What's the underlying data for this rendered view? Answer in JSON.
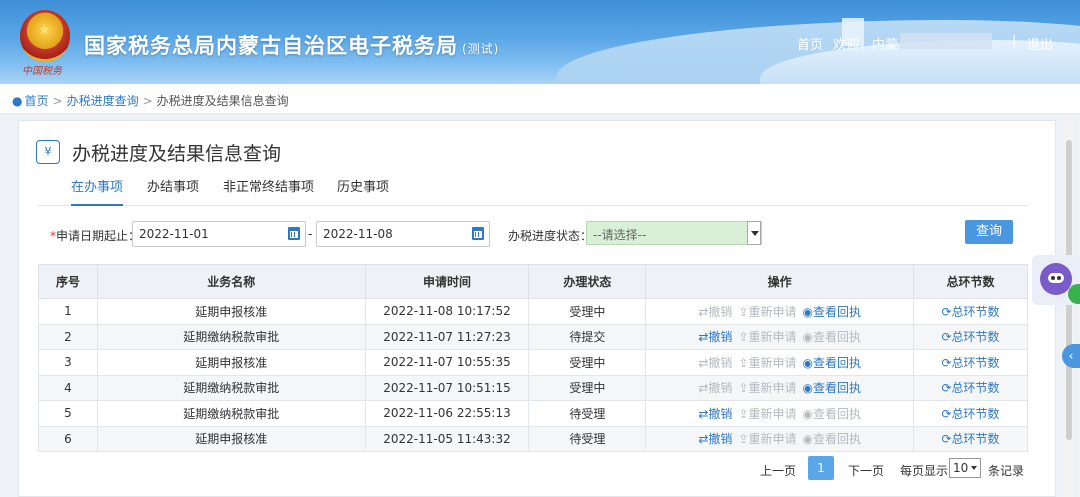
{
  "header": {
    "emblem_script": "中国税务",
    "title": "国家税务总局内蒙古自治区电子税务局",
    "subtitle": "(测试)",
    "nav_home": "首页",
    "welcome": "欢迎，内蒙",
    "separator": "|",
    "logout": "退出"
  },
  "breadcrumb": {
    "home": "首页",
    "arrow": ">",
    "level1": "办税进度查询",
    "level2": "办税进度及结果信息查询"
  },
  "page": {
    "icon_text": "¥",
    "title": "办税进度及结果信息查询",
    "tabs": [
      "在办事项",
      "办结事项",
      "非正常终结事项",
      "历史事项"
    ]
  },
  "filters": {
    "required_mark": "*",
    "date_label": "申请日期起止：",
    "date_start": "2022-11-01",
    "date_end": "2022-11-08",
    "dash": "-",
    "status_label": "办税进度状态：",
    "status_placeholder": "--请选择--",
    "query_button": "查询"
  },
  "table": {
    "headers": [
      "序号",
      "业务名称",
      "申请时间",
      "办理状态",
      "操作",
      "总环节数"
    ],
    "op_labels": {
      "revoke": "⇄撤销",
      "resubmit": "⇪重新申请",
      "view": "◉查看回执"
    },
    "total_label": "⟳总环节数",
    "rows": [
      {
        "no": "1",
        "name": "延期申报核准",
        "time": "2022-11-08 10:17:52",
        "status": "受理中",
        "revoke": false,
        "resubmit": false,
        "view": true
      },
      {
        "no": "2",
        "name": "延期缴纳税款审批",
        "time": "2022-11-07 11:27:23",
        "status": "待提交",
        "revoke": true,
        "resubmit": false,
        "view": false
      },
      {
        "no": "3",
        "name": "延期申报核准",
        "time": "2022-11-07 10:55:35",
        "status": "受理中",
        "revoke": false,
        "resubmit": false,
        "view": true
      },
      {
        "no": "4",
        "name": "延期缴纳税款审批",
        "time": "2022-11-07 10:51:15",
        "status": "受理中",
        "revoke": false,
        "resubmit": false,
        "view": true
      },
      {
        "no": "5",
        "name": "延期缴纳税款审批",
        "time": "2022-11-06 22:55:13",
        "status": "待受理",
        "revoke": true,
        "resubmit": false,
        "view": false
      },
      {
        "no": "6",
        "name": "延期申报核准",
        "time": "2022-11-05 11:43:32",
        "status": "待受理",
        "revoke": true,
        "resubmit": false,
        "view": false
      }
    ]
  },
  "pagination": {
    "prev": "上一页",
    "current": "1",
    "next": "下一页",
    "per_page_label": "每页显示",
    "per_page": "10",
    "records_label": "条记录"
  },
  "colors": {
    "accent": "#2f78c4",
    "disabled": "#b5b9bf",
    "required": "#e23a2e",
    "select_bg": "#d9efd7"
  }
}
